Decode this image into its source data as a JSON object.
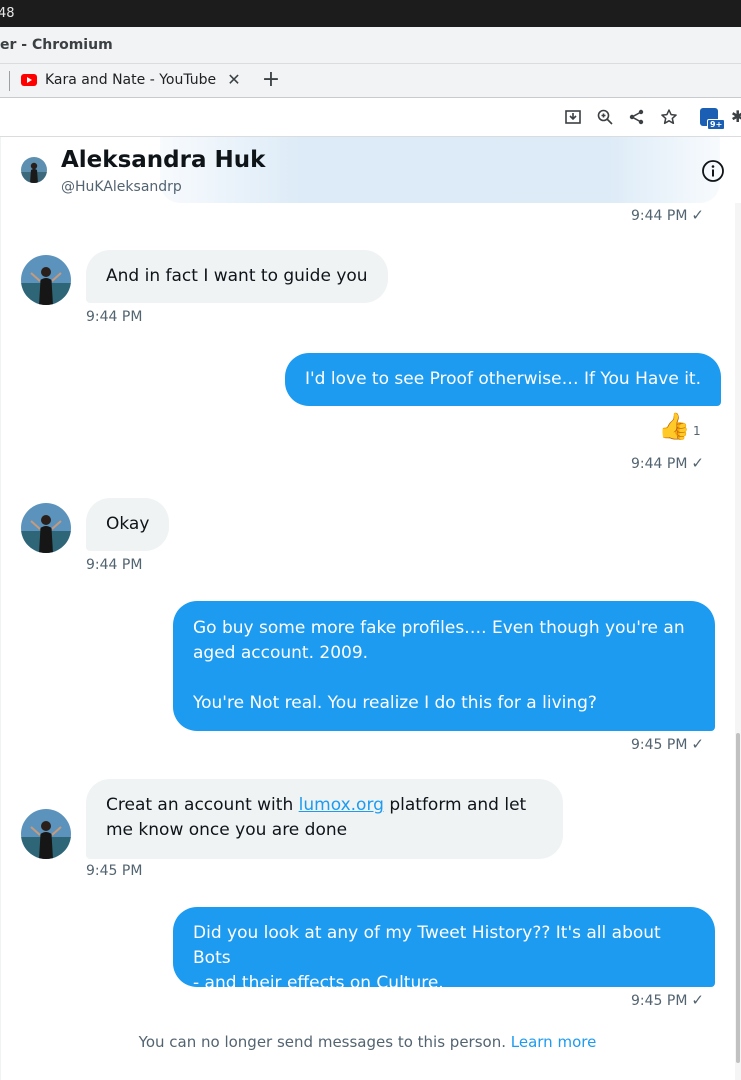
{
  "os": {
    "clock_fragment": "48"
  },
  "window": {
    "title": "er - Chromium"
  },
  "tabs": [
    {
      "title": "Kara and Nate - YouTube",
      "close": "✕"
    }
  ],
  "new_tab": "+",
  "toolbar": {
    "icons": [
      "install-icon",
      "zoom-icon",
      "share-icon",
      "bookmark-star-icon",
      "extension-icon",
      "puzzle-icon"
    ],
    "extension_badge": "9+"
  },
  "conversation": {
    "name": "Aleksandra Huk",
    "handle": "@HuKAleksandrp",
    "info_icon": "info-icon"
  },
  "messages": [
    {
      "direction": "out",
      "time": "9:44 PM",
      "status": "✓",
      "text": ""
    },
    {
      "direction": "in",
      "text": "And in fact I want to guide you",
      "time": "9:44 PM"
    },
    {
      "direction": "out",
      "text": "I'd love to see Proof otherwise… If You Have it.",
      "reaction": "👍",
      "reaction_count": "1",
      "time": "9:44 PM",
      "status": "✓"
    },
    {
      "direction": "in",
      "text": "Okay",
      "time": "9:44 PM"
    },
    {
      "direction": "out",
      "text_lines": [
        "Go buy some more fake profiles…. Even though you're an",
        "aged account. 2009.",
        "",
        "You're Not real. You realize I do this for a living?"
      ],
      "time": "9:45 PM",
      "status": "✓"
    },
    {
      "direction": "in",
      "text_before": "Creat an account with ",
      "link": "lumox.org",
      "text_after_line1": " platform and let",
      "text_line2": "me know once you are done",
      "time": "9:45 PM"
    },
    {
      "direction": "out",
      "text_lines": [
        "Did you look at any of my Tweet History?? It's all about Bots",
        "- and their effects on Culture."
      ],
      "time": "9:45 PM",
      "status": "✓"
    }
  ],
  "footer": {
    "notice": "You can no longer send messages to this person.",
    "learn_more": "Learn more"
  },
  "colors": {
    "accent": "#1d9bf0",
    "incoming_bubble": "#eff3f4",
    "secondary_text": "#536471"
  }
}
